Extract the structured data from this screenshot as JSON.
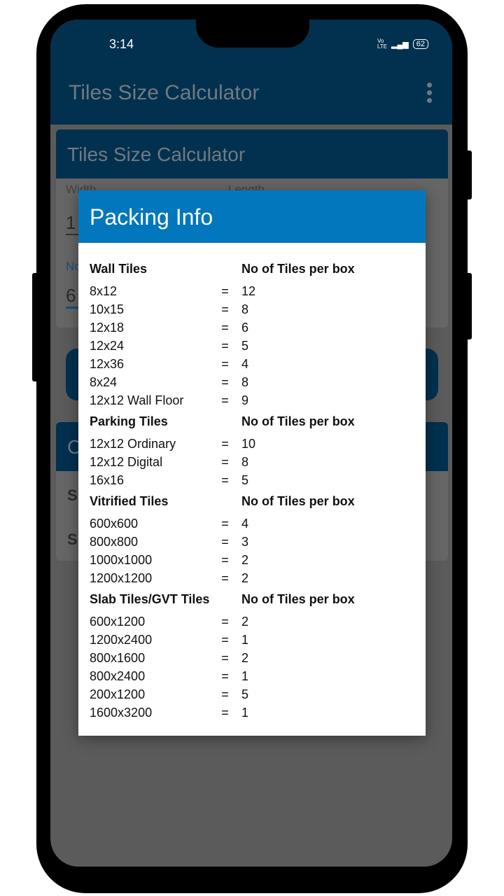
{
  "status_bar": {
    "time": "3:14",
    "network": "Vo LTE",
    "battery": "62"
  },
  "app_bar": {
    "title": "Tiles Size Calculator",
    "menu_icon": "more-vert-icon"
  },
  "background": {
    "card_title": "Tiles Size Calculator",
    "field1_label": "Width",
    "field2_label": "Length",
    "field1_value": "1",
    "field3_label": "No",
    "field3_value": "6",
    "card2_title": "C",
    "row1": "S",
    "row2": "S"
  },
  "colors": {
    "app_bar": "#02314f",
    "dialog_header": "#0277bd"
  },
  "dialog": {
    "title": "Packing Info",
    "sections": [
      {
        "title": "Wall Tiles",
        "col_header": "No of Tiles per box",
        "items": [
          [
            "8x12",
            "=",
            "12"
          ],
          [
            "10x15",
            "=",
            "8"
          ],
          [
            "12x18",
            "=",
            "6"
          ],
          [
            "12x24",
            "=",
            "5"
          ],
          [
            "12x36",
            "=",
            "4"
          ],
          [
            "8x24",
            "=",
            "8"
          ],
          [
            "12x12 Wall Floor",
            "=",
            "9"
          ]
        ]
      },
      {
        "title": "Parking Tiles",
        "col_header": "No of Tiles per box",
        "items": [
          [
            "12x12 Ordinary",
            "=",
            "10"
          ],
          [
            "12x12 Digital",
            "=",
            "8"
          ],
          [
            "16x16",
            "=",
            "5"
          ]
        ]
      },
      {
        "title": "Vitrified Tiles",
        "col_header": "No of Tiles per box",
        "items": [
          [
            "600x600",
            "=",
            "4"
          ],
          [
            "800x800",
            "=",
            "3"
          ],
          [
            "1000x1000",
            "=",
            "2"
          ],
          [
            "1200x1200",
            "=",
            "2"
          ]
        ]
      },
      {
        "title": "Slab Tiles/GVT Tiles",
        "col_header": "No of Tiles per box",
        "items": [
          [
            "600x1200",
            "=",
            "2"
          ],
          [
            "1200x2400",
            "=",
            "1"
          ],
          [
            "800x1600",
            "=",
            "2"
          ],
          [
            "800x2400",
            "=",
            "1"
          ],
          [
            "200x1200",
            "=",
            "5"
          ],
          [
            "1600x3200",
            "=",
            "1"
          ]
        ]
      }
    ]
  }
}
